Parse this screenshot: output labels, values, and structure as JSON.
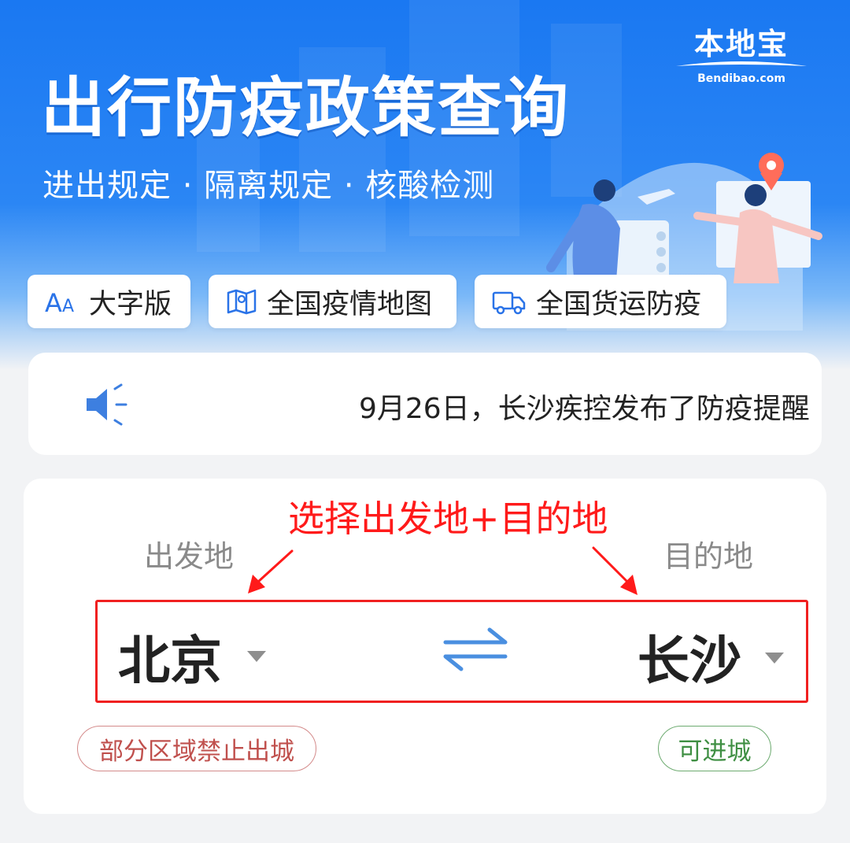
{
  "banner": {
    "title": "出行防疫政策查询",
    "subtitle": "进出规定 · 隔离规定 · 核酸检测",
    "brand_cn": "本地宝",
    "brand_en": "Bendibao.com"
  },
  "quick_links": [
    {
      "label": "大字版",
      "icon": "font-size-icon"
    },
    {
      "label": "全国疫情地图",
      "icon": "map-icon"
    },
    {
      "label": "全国货运防疫",
      "icon": "truck-icon"
    }
  ],
  "notice": {
    "icon": "speaker-icon",
    "text": "9月26日，长沙疾控发布了防疫提醒"
  },
  "route": {
    "callout": "选择出发地+目的地",
    "origin_label": "出发地",
    "destination_label": "目的地",
    "origin_city": "北京",
    "destination_city": "长沙",
    "origin_status": "部分区域禁止出城",
    "destination_status": "可进城"
  },
  "colors": {
    "brand_blue": "#1a78f2",
    "annotation_red": "#f02020",
    "warning_red": "#c0504d",
    "ok_green": "#3f8f43",
    "swap_blue": "#4a8fe0"
  }
}
